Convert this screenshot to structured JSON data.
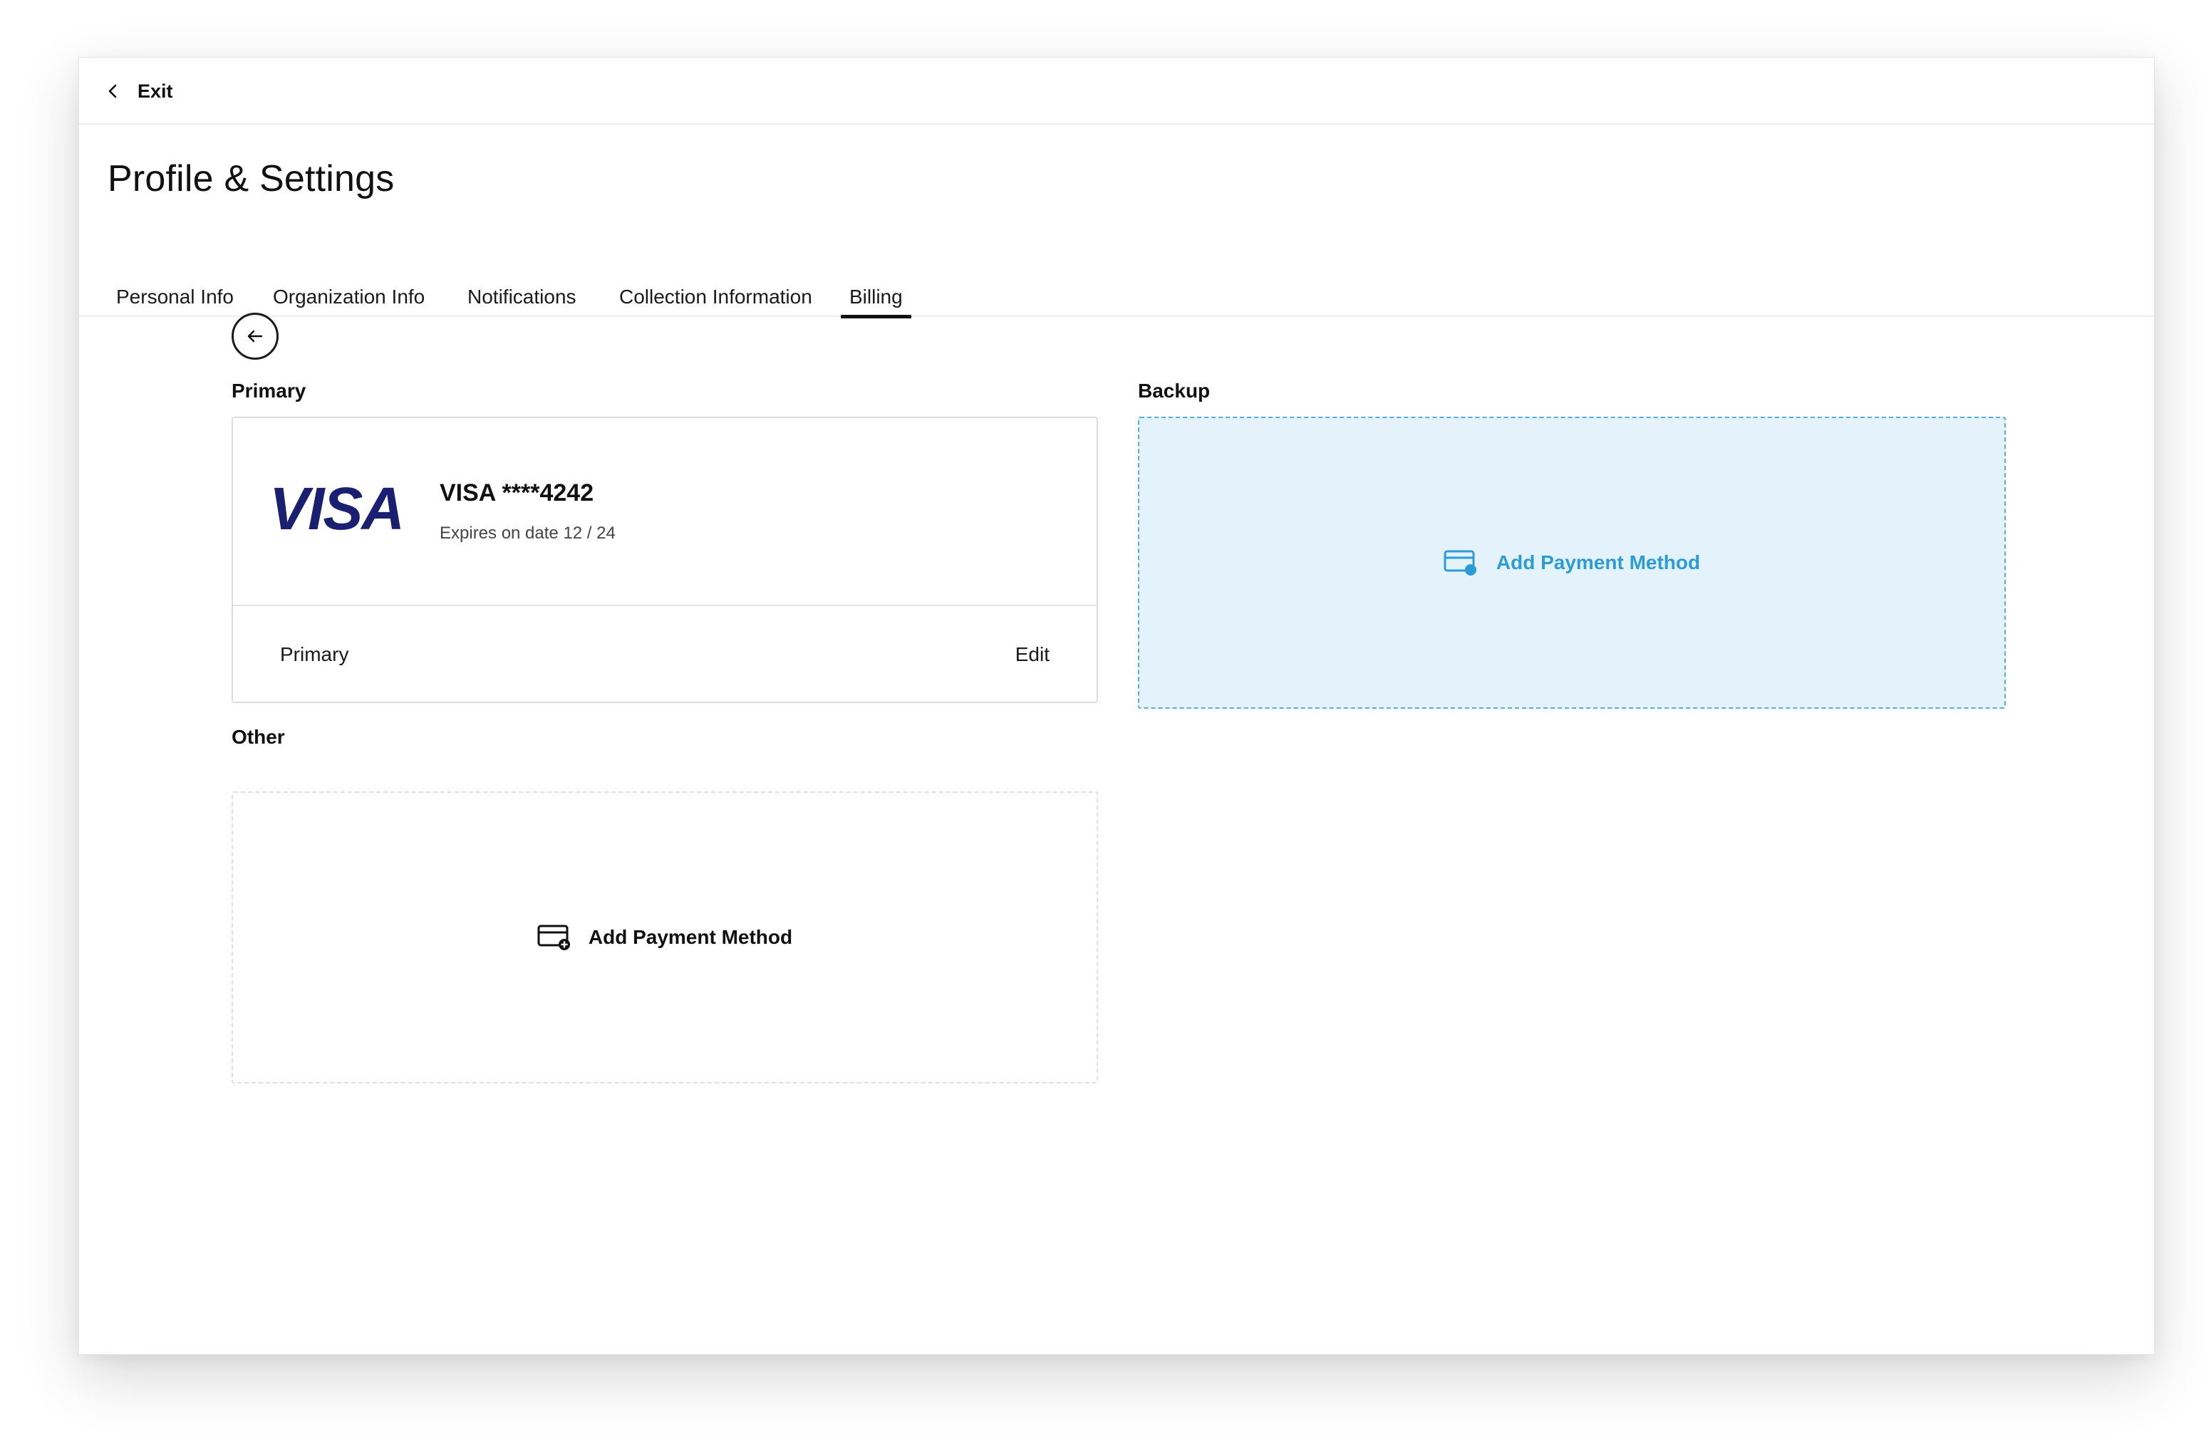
{
  "topbar": {
    "exit_label": "Exit",
    "exit_icon": "chevron-left-icon"
  },
  "page": {
    "title": "Profile & Settings"
  },
  "tabs": [
    {
      "label": "Personal Info",
      "active": false
    },
    {
      "label": "Organization Info",
      "active": false
    },
    {
      "label": "Notifications",
      "active": false
    },
    {
      "label": "Collection Information",
      "active": false
    },
    {
      "label": "Billing",
      "active": true
    }
  ],
  "billing": {
    "back_icon": "arrow-left-icon",
    "primary_label": "Primary",
    "backup_label": "Backup",
    "other_label": "Other",
    "primary_card": {
      "brand": "VISA",
      "number": "VISA ****4242",
      "expiry": "Expires on date 12 / 24",
      "footer_label": "Primary",
      "edit_label": "Edit"
    },
    "backup_add": {
      "label": "Add Payment Method",
      "icon": "add-card-icon"
    },
    "other_add": {
      "label": "Add Payment Method",
      "icon": "add-card-icon"
    }
  },
  "colors": {
    "accent": "#2b9cd8",
    "backup_bg": "#e4f3fb",
    "visa_blue": "#1a1f71",
    "text": "#111111"
  }
}
